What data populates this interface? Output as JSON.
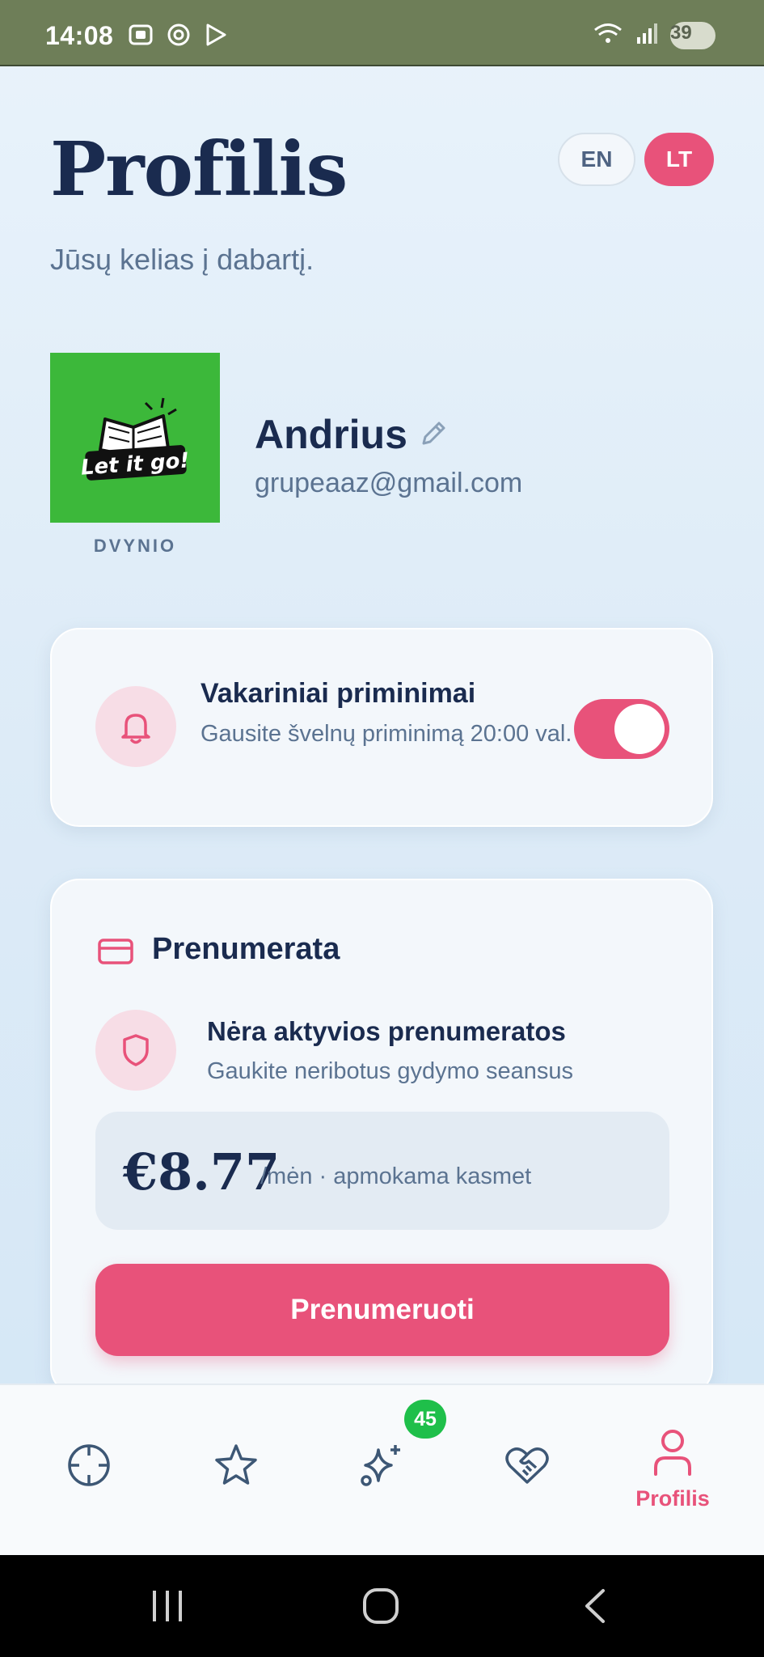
{
  "status_bar": {
    "time": "14:08",
    "battery": "39"
  },
  "header": {
    "title": "Profilis",
    "subtitle": "Jūsų kelias į dabartį."
  },
  "language": {
    "en_label": "EN",
    "lt_label": "LT",
    "active": "LT"
  },
  "profile": {
    "avatar_text": "Let it go!",
    "zodiac": "DVYNIO",
    "name": "Andrius",
    "email": "grupeaaz@gmail.com"
  },
  "reminder": {
    "title": "Vakariniai priminimai",
    "description": "Gausite švelnų priminimą 20:00 val.",
    "enabled": true
  },
  "subscription": {
    "title": "Prenumerata",
    "status": "Nėra aktyvios prenumeratos",
    "description": "Gaukite neribotus gydymo seansus",
    "price": "€8.77",
    "period": "/mėn · apmokama kasmet",
    "button_label": "Prenumeruoti"
  },
  "bottom_nav": {
    "items": [
      {
        "icon": "crosshair-icon",
        "label": ""
      },
      {
        "icon": "star-icon",
        "label": ""
      },
      {
        "icon": "sparkles-icon",
        "label": "",
        "badge": "45"
      },
      {
        "icon": "heart-handshake-icon",
        "label": ""
      },
      {
        "icon": "user-icon",
        "label": "Profilis",
        "active": true
      }
    ]
  },
  "colors": {
    "accent": "#e8527a",
    "title": "#1a2b4f",
    "muted": "#5b7391",
    "badge": "#1fbf4a"
  }
}
